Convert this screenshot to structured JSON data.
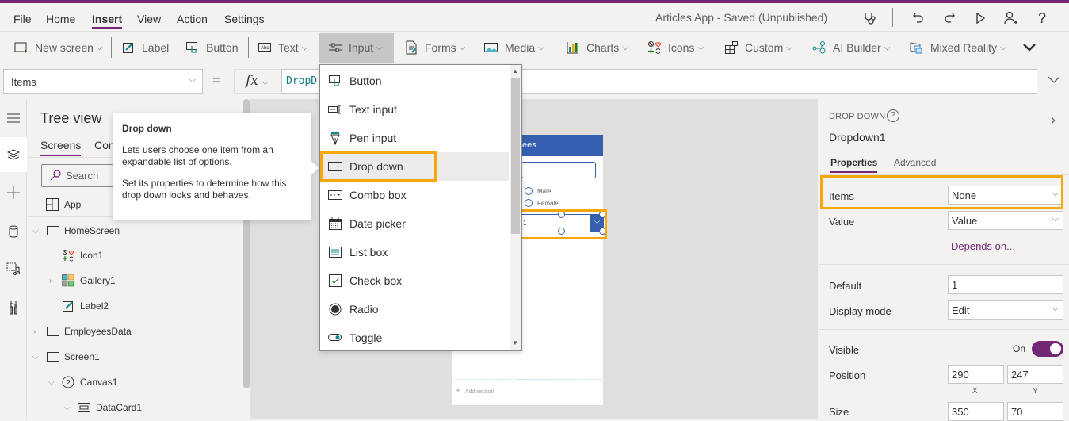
{
  "colors": {
    "brand": "#742774",
    "highlight": "#f7a707",
    "phone_header": "#3560b0",
    "formula_text": "#0e7a8a"
  },
  "menubar": {
    "items": [
      "File",
      "Home",
      "Insert",
      "View",
      "Action",
      "Settings"
    ],
    "active": "Insert",
    "app_title": "Articles App - Saved (Unpublished)",
    "icons": [
      "app-checker-icon",
      "undo-icon",
      "redo-icon",
      "play-icon",
      "share-user-icon",
      "help-icon"
    ]
  },
  "ribbon": {
    "items": [
      {
        "label": "New screen",
        "icon": "new-screen-icon",
        "dropdown": true
      },
      {
        "label": "Label",
        "icon": "label-icon",
        "dropdown": false
      },
      {
        "label": "Button",
        "icon": "button-icon",
        "dropdown": false
      },
      {
        "label": "Text",
        "icon": "text-icon",
        "dropdown": true
      },
      {
        "label": "Input",
        "icon": "input-icon",
        "dropdown": true,
        "active": true
      },
      {
        "label": "Forms",
        "icon": "forms-icon",
        "dropdown": true
      },
      {
        "label": "Media",
        "icon": "media-icon",
        "dropdown": true
      },
      {
        "label": "Charts",
        "icon": "charts-icon",
        "dropdown": true
      },
      {
        "label": "Icons",
        "icon": "icons-icon",
        "dropdown": true
      },
      {
        "label": "Custom",
        "icon": "custom-icon",
        "dropdown": true
      },
      {
        "label": "AI Builder",
        "icon": "ai-builder-icon",
        "dropdown": true
      },
      {
        "label": "Mixed Reality",
        "icon": "mixed-reality-icon",
        "dropdown": true
      }
    ]
  },
  "formula": {
    "property": "Items",
    "equals": "=",
    "fx": "fx",
    "value": "DropD"
  },
  "input_menu": {
    "items": [
      {
        "label": "Button",
        "icon": "button-icon"
      },
      {
        "label": "Text input",
        "icon": "text-input-icon"
      },
      {
        "label": "Pen input",
        "icon": "pen-input-icon"
      },
      {
        "label": "Drop down",
        "icon": "dropdown-icon",
        "highlighted": true
      },
      {
        "label": "Combo box",
        "icon": "combo-box-icon"
      },
      {
        "label": "Date picker",
        "icon": "date-picker-icon"
      },
      {
        "label": "List box",
        "icon": "list-box-icon"
      },
      {
        "label": "Check box",
        "icon": "check-box-icon"
      },
      {
        "label": "Radio",
        "icon": "radio-icon"
      },
      {
        "label": "Toggle",
        "icon": "toggle-icon"
      }
    ]
  },
  "tooltip": {
    "title": "Drop down",
    "p1": "Lets users choose one item from an expandable list of options.",
    "p2": "Set its properties to determine how this drop down looks and behaves."
  },
  "tree": {
    "title": "Tree view",
    "tabs": [
      "Screens",
      "Com"
    ],
    "search_placeholder": "Search",
    "rows": [
      {
        "label": "App",
        "icon": "app-icon",
        "level": 0,
        "expander": ""
      },
      {
        "label": "HomeScreen",
        "icon": "screen-icon",
        "level": 0,
        "expander": "down"
      },
      {
        "label": "Icon1",
        "icon": "icons-icon",
        "level": 1,
        "expander": ""
      },
      {
        "label": "Gallery1",
        "icon": "gallery-icon",
        "level": 1,
        "expander": "right"
      },
      {
        "label": "Label2",
        "icon": "label-icon",
        "level": 1,
        "expander": ""
      },
      {
        "label": "EmployeesData",
        "icon": "screen-icon",
        "level": 0,
        "expander": "right"
      },
      {
        "label": "Screen1",
        "icon": "screen-icon",
        "level": 0,
        "expander": "down"
      },
      {
        "label": "Canvas1",
        "icon": "canvas-icon",
        "level": 1,
        "expander": "down"
      },
      {
        "label": "DataCard1",
        "icon": "datacard-icon",
        "level": 2,
        "expander": "down"
      }
    ]
  },
  "canvas": {
    "header": "loyees",
    "radio_options": [
      "Male",
      "Female"
    ],
    "dropdown_value": "1",
    "add_section": "Add section"
  },
  "properties": {
    "type": "DROP DOWN",
    "name": "Dropdown1",
    "tabs": [
      "Properties",
      "Advanced"
    ],
    "items_label": "Items",
    "items_value": "None",
    "value_label": "Value",
    "value_value": "Value",
    "depends_on": "Depends on...",
    "default_label": "Default",
    "default_value": "1",
    "display_mode_label": "Display mode",
    "display_mode_value": "Edit",
    "visible_label": "Visible",
    "visible_state": "On",
    "position_label": "Position",
    "position_x": "290",
    "position_y": "247",
    "x_label": "X",
    "y_label": "Y",
    "size_label": "Size",
    "size_w": "350",
    "size_h": "70"
  }
}
